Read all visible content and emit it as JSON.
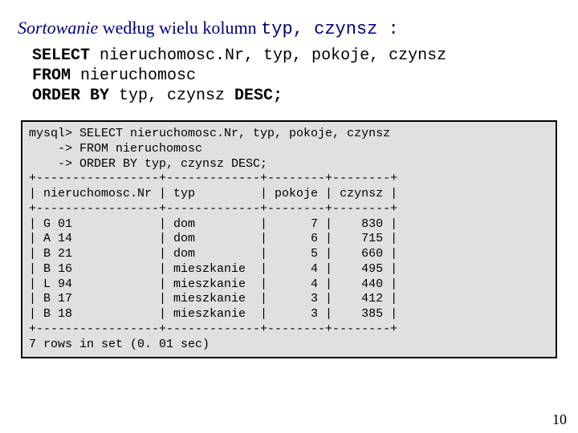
{
  "title": {
    "italic": "Sortowanie",
    "rest": " według wielu kolumn ",
    "mono": "typ, czynsz :"
  },
  "sql": {
    "line1a": "SELECT",
    "line1b": " nieruchomosc.Nr, typ, pokoje, czynsz",
    "line2a": "FROM",
    "line2b": " nieruchomosc",
    "line3a": "ORDER BY",
    "line3b": " typ, czynsz ",
    "line3c": "DESC;"
  },
  "terminal": {
    "prompt1": "mysql> SELECT nieruchomosc.Nr, typ, pokoje, czynsz",
    "prompt2": "    -> FROM nieruchomosc",
    "prompt3": "    -> ORDER BY typ, czynsz DESC;",
    "sep": "+-----------------+-------------+--------+--------+",
    "header": "| nieruchomosc.Nr | typ         | pokoje | czynsz |",
    "r1": "| G 01            | dom         |      7 |    830 |",
    "r2": "| A 14            | dom         |      6 |    715 |",
    "r3": "| B 21            | dom         |      5 |    660 |",
    "r4": "| B 16            | mieszkanie  |      4 |    495 |",
    "r5": "| L 94            | mieszkanie  |      4 |    440 |",
    "r6": "| B 17            | mieszkanie  |      3 |    412 |",
    "r7": "| B 18            | mieszkanie  |      3 |    385 |",
    "footer": "7 rows in set (0. 01 sec)"
  },
  "chart_data": {
    "type": "table",
    "columns": [
      "nieruchomosc.Nr",
      "typ",
      "pokoje",
      "czynsz"
    ],
    "rows": [
      [
        "G 01",
        "dom",
        7,
        830
      ],
      [
        "A 14",
        "dom",
        6,
        715
      ],
      [
        "B 21",
        "dom",
        5,
        660
      ],
      [
        "B 16",
        "mieszkanie",
        4,
        495
      ],
      [
        "L 94",
        "mieszkanie",
        4,
        440
      ],
      [
        "B 17",
        "mieszkanie",
        3,
        412
      ],
      [
        "B 18",
        "mieszkanie",
        3,
        385
      ]
    ],
    "summary": "7 rows in set (0. 01 sec)"
  },
  "page_number": "10"
}
